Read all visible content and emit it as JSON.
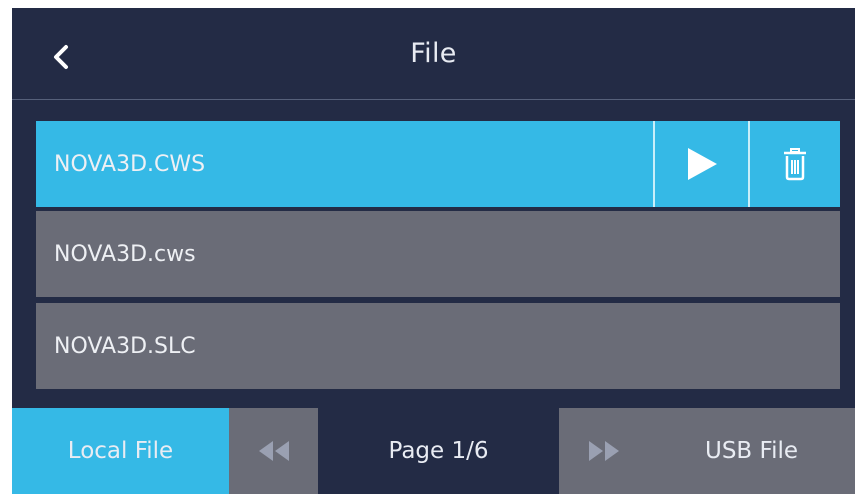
{
  "header": {
    "title": "File"
  },
  "files": [
    {
      "name": "NOVA3D.CWS",
      "selected": true
    },
    {
      "name": "NOVA3D.cws",
      "selected": false
    },
    {
      "name": "NOVA3D.SLC",
      "selected": false
    }
  ],
  "footer": {
    "local_label": "Local File",
    "page_label": "Page 1/6",
    "usb_label": "USB File"
  },
  "colors": {
    "background": "#232b45",
    "accent": "#35b9e6",
    "row": "#6a6c77"
  },
  "icons": [
    "chevron-left-icon",
    "play-icon",
    "trash-icon",
    "rewind-icon",
    "fast-forward-icon"
  ]
}
